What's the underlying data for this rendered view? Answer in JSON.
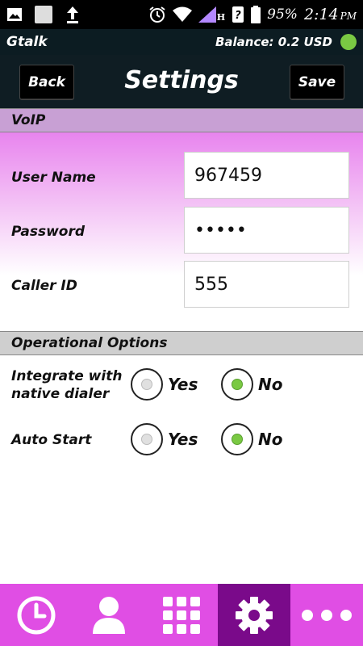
{
  "status_bar": {
    "battery": "95%",
    "time": "2:14",
    "ampm": "PM",
    "network_label": "H"
  },
  "app_bar": {
    "app_name": "Gtalk",
    "balance": "Balance: 0.2 USD",
    "status_color": "#7ac943"
  },
  "header": {
    "back_label": "Back",
    "title": "Settings",
    "save_label": "Save"
  },
  "voip": {
    "section_title": "VoIP",
    "username_label": "User Name",
    "username_value": "967459",
    "password_label": "Password",
    "password_value": "•••••",
    "callerid_label": "Caller ID",
    "callerid_value": "555"
  },
  "options": {
    "section_title": "Operational Options",
    "integrate_label_line1": "Integrate with",
    "integrate_label_line2": "native dialer",
    "integrate_selected": "No",
    "autostart_label": "Auto Start",
    "autostart_selected": "No",
    "yes_label": "Yes",
    "no_label": "No"
  },
  "bottom_nav": {
    "items": [
      {
        "icon": "clock-icon",
        "active": false
      },
      {
        "icon": "contacts-icon",
        "active": false
      },
      {
        "icon": "dialpad-icon",
        "active": false
      },
      {
        "icon": "settings-gear-icon",
        "active": true
      },
      {
        "icon": "more-icon",
        "active": false
      }
    ],
    "background": "#e04ee4",
    "active_background": "#7a0a8a"
  }
}
